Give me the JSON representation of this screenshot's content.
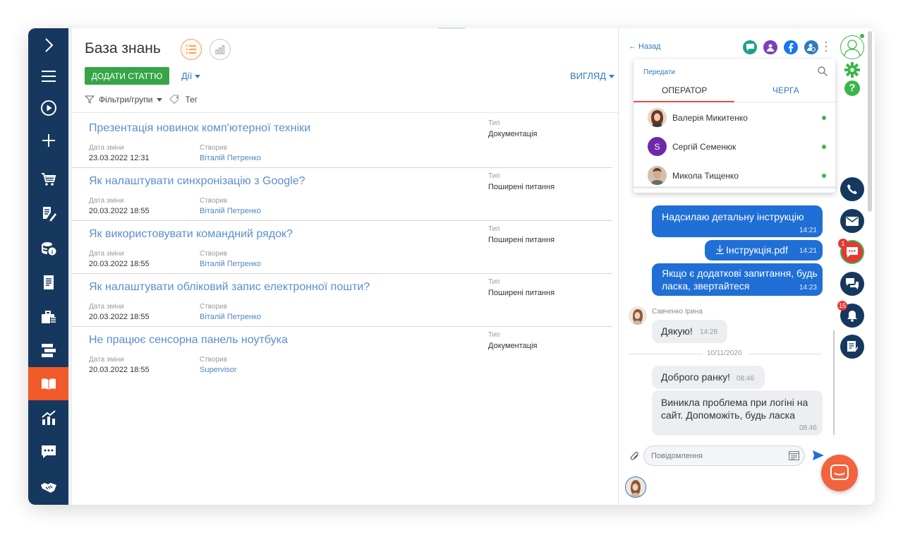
{
  "app": {
    "page_title": "База знань",
    "add_button": "ДОДАТИ СТАТТЮ",
    "actions_label": "Дії",
    "view_label": "ВИГЛЯД",
    "filters_label": "Фільтри/групи",
    "tag_label": "Тег"
  },
  "nav": {
    "items": [
      "expand-icon",
      "menu-icon",
      "play-icon",
      "plus-icon",
      "cart-icon",
      "edit-document-icon",
      "finance-icon",
      "document-icon",
      "briefcase-icon",
      "steps-icon",
      "book-icon",
      "analytics-icon",
      "chat-bubble-icon",
      "handshake-icon"
    ],
    "active": "book-icon",
    "active_color": "#f15a29",
    "background": "#16385e"
  },
  "labels": {
    "date_changed": "Дата зміни",
    "created_by": "Створив",
    "type": "Тип"
  },
  "articles": [
    {
      "title": "Презентація новинок комп'ютерної техніки",
      "date": "23.03.2022 12:31",
      "author": "Віталій Петренко",
      "type": "Документація"
    },
    {
      "title": "Як налаштувати синхронізацію з Google?",
      "date": "20.03.2022 18:55",
      "author": "Віталій Петренко",
      "type": "Поширені питання"
    },
    {
      "title": "Як використовувати командний рядок?",
      "date": "20.03.2022 18:55",
      "author": "Віталій Петренко",
      "type": "Поширені питання"
    },
    {
      "title": "Як налаштувати обліковий запис електронної пошти?",
      "date": "20.03.2022 18:55",
      "author": "Віталій Петренко",
      "type": "Поширені питання"
    },
    {
      "title": "Не працює сенсорна панель ноутбука",
      "date": "20.03.2022 18:55",
      "author": "Supervisor",
      "type": "Документація"
    }
  ],
  "chat": {
    "back_label": "← Назад",
    "transfer": {
      "title": "Передати",
      "tab_operator": "ОПЕРАТОР",
      "tab_queue": "ЧЕРГА",
      "operators": [
        {
          "name": "Валерія Микитенко",
          "avatar": "photo"
        },
        {
          "name": "Сергій Семенюк",
          "avatar": "S"
        },
        {
          "name": "Микола Тищенко",
          "avatar": "photo"
        }
      ]
    },
    "messages_out": [
      {
        "text": "Надсилаю детальну інструкцію",
        "time": "14:21"
      },
      {
        "file": "Інструкція.pdf",
        "time": "14:21"
      },
      {
        "text_line1": "Якщо є додаткові запитання, будь",
        "text_line2": "ласка, звертайтеся",
        "time": "14:23"
      }
    ],
    "sender_name": "Савченко Ірина",
    "messages_in": [
      {
        "text": "Дякую!",
        "time": "14:28"
      },
      {
        "text": "Доброго ранку!",
        "time": "08:46"
      },
      {
        "text_line1": "Виникла проблема при логіні на",
        "text_line2": "сайт. Допоможіть, будь ласка",
        "time": "08:46"
      }
    ],
    "date_separator": "10/11/2020",
    "input_placeholder": "Повідомлення"
  },
  "rail": {
    "badges": {
      "chat": "1",
      "notifications": "15"
    }
  },
  "colors": {
    "accent_blue": "#1f6fd6",
    "green": "#36a547",
    "link": "#5b8fcb"
  }
}
